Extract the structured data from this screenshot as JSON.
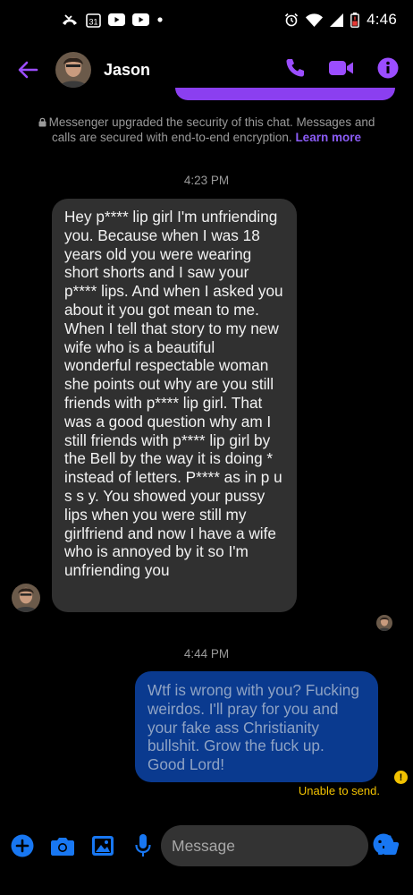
{
  "status_bar": {
    "time": "4:46",
    "calendar_date": "31"
  },
  "header": {
    "contact_name": "Jason"
  },
  "notice": {
    "text": "Messenger upgraded the security of this chat. Messages and calls are secured with end-to-end encryption.",
    "link": "Learn more"
  },
  "thread": {
    "timestamp_1": "4:23 PM",
    "incoming_message": "Hey p**** lip girl I'm unfriending you. Because when I was 18 years old you were wearing short shorts and I saw your p**** lips. And when I asked you about it you got mean to me. When I tell that story to my new wife who is a beautiful wonderful respectable woman she points out why are you still friends with p**** lip girl. That was a good question why am I still friends with p**** lip girl by the Bell by the way it is doing * instead of letters. P**** as in p u s s y. You showed your pussy lips when you were still my girlfriend and now I have a wife who is annoyed by it so I'm unfriending you",
    "timestamp_2": "4:44 PM",
    "outgoing_message": "Wtf is wrong with you? Fucking weirdos. I'll pray for you and your fake ass Christianity bullshit. Grow the fuck up. Good Lord!",
    "error_text": "Unable to send."
  },
  "composer": {
    "placeholder": "Message"
  },
  "colors": {
    "accent": "#9b4dff",
    "blue": "#1877f2",
    "outgoing_bubble": "#0a3a8f",
    "warning": "#f2c200"
  }
}
